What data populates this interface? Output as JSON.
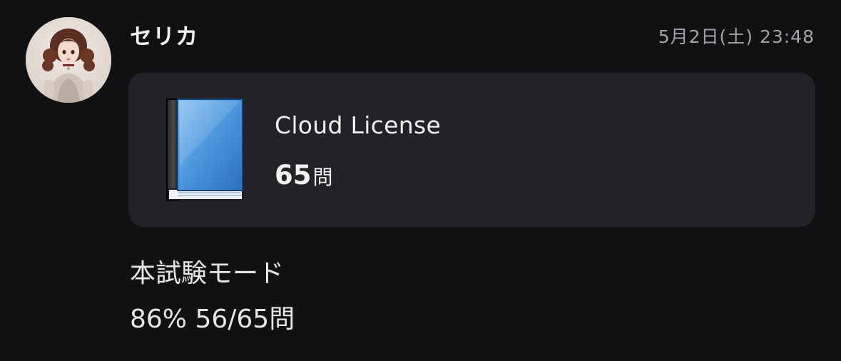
{
  "post": {
    "username": "セリカ",
    "timestamp": "5月2日(土) 23:48",
    "avatar_icon": "doll-portrait-avatar"
  },
  "card": {
    "icon": "blue-book-icon",
    "title": "Cloud License",
    "count": "65",
    "count_unit": "問"
  },
  "message": {
    "mode": "本試験モード",
    "result": "86% 56/65問"
  },
  "colors": {
    "background": "#111113",
    "card_background": "#232327",
    "text": "#ececec",
    "muted_text": "#a4a4a8",
    "book_blue": "#3a86d4"
  }
}
